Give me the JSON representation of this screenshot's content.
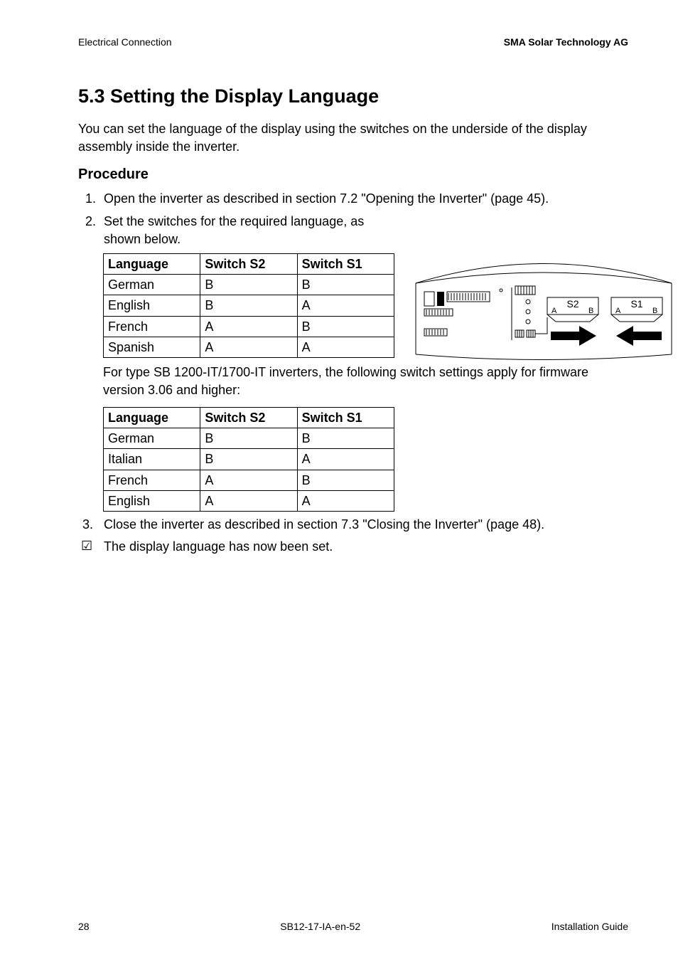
{
  "header": {
    "left": "Electrical Connection",
    "right": "SMA Solar Technology AG"
  },
  "section": {
    "number_title": "5.3  Setting the Display Language",
    "intro": "You can set the language of the display using the switches on the underside of the display assembly inside the inverter.",
    "procedure_heading": "Procedure",
    "step1": "Open the inverter as described in section 7.2 \"Opening the Inverter\" (page 45).",
    "step2_line1": "Set the switches for the required language, as",
    "step2_line2": "shown below.",
    "note_after_table1": "For type SB 1200-IT/1700-IT inverters, the following switch settings apply for firmware version 3.06 and higher:",
    "step3": "Close the inverter as described in section 7.3 \"Closing the Inverter\" (page 48).",
    "result": "The display language has now been set."
  },
  "table_headers": {
    "col1": "Language",
    "col2": "Switch S2",
    "col3": "Switch S1"
  },
  "table1": [
    {
      "lang": "German",
      "s2": "B",
      "s1": "B"
    },
    {
      "lang": "English",
      "s2": "B",
      "s1": "A"
    },
    {
      "lang": "French",
      "s2": "A",
      "s1": "B"
    },
    {
      "lang": "Spanish",
      "s2": "A",
      "s1": "A"
    }
  ],
  "table2": [
    {
      "lang": "German",
      "s2": "B",
      "s1": "B"
    },
    {
      "lang": "Italian",
      "s2": "B",
      "s1": "A"
    },
    {
      "lang": "French",
      "s2": "A",
      "s1": "B"
    },
    {
      "lang": "English",
      "s2": "A",
      "s1": "A"
    }
  ],
  "diagram": {
    "s2_label": "S2",
    "s1_label": "S1",
    "a_label": "A",
    "b_label": "B"
  },
  "footer": {
    "page": "28",
    "doc": "SB12-17-IA-en-52",
    "guide": "Installation Guide"
  }
}
